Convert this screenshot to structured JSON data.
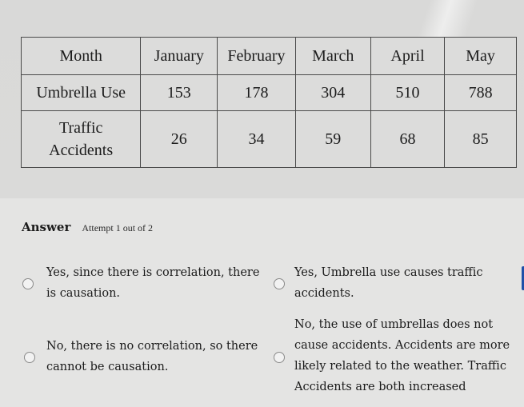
{
  "table": {
    "header": [
      "Month",
      "January",
      "February",
      "March",
      "April",
      "May"
    ],
    "rows": [
      {
        "label": "Umbrella Use",
        "values": [
          "153",
          "178",
          "304",
          "510",
          "788"
        ]
      },
      {
        "label_line1": "Traffic",
        "label_line2": "Accidents",
        "values": [
          "26",
          "34",
          "59",
          "68",
          "85"
        ]
      }
    ]
  },
  "answer": {
    "heading": "Answer",
    "attempt": "Attempt 1 out of 2"
  },
  "options": [
    {
      "lines": [
        "Yes, since there is correlation, there",
        "is causation."
      ],
      "selected": false
    },
    {
      "lines": [
        "Yes, Umbrella use causes traffic",
        "accidents."
      ],
      "selected": false
    },
    {
      "lines": [
        "No, there is no correlation, so there",
        "cannot be causation."
      ],
      "selected": false
    },
    {
      "lines": [
        "No, the use of umbrellas does not",
        "cause accidents. Accidents are more",
        "likely related to the weather. Traffic",
        "Accidents are both increased"
      ],
      "selected": false
    }
  ],
  "colors": {
    "accent": "#1f4fa8",
    "background": "#dcdcdb",
    "text": "#1b1b1b"
  }
}
